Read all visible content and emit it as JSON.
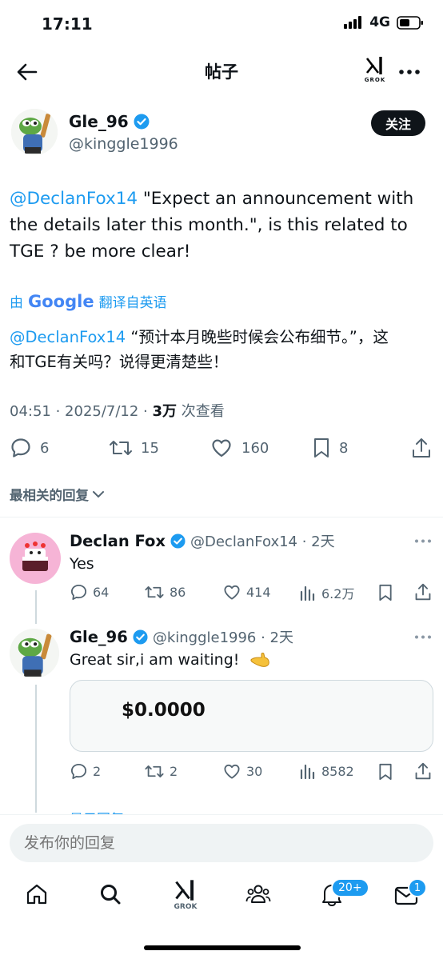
{
  "status_bar": {
    "time": "17:11",
    "network": "4G"
  },
  "header": {
    "title": "帖子",
    "grok_label": "GROK"
  },
  "post": {
    "display_name": "Gle_96",
    "handle": "@kinggle1996",
    "follow_label": "关注",
    "mention": "@DeclanFox14",
    "text_line1": " \"Expect an announcement with",
    "text_line2": "the details later this month.\", is this related to",
    "text_line3": "TGE ? be more clear!",
    "translate_prefix": "由",
    "translate_brand": "Google",
    "translate_suffix": "翻译自英语",
    "translated_mention": "@DeclanFox14",
    "translated_line1": " “预计本月晚些时候会公布细节。”，这",
    "translated_line2": "和TGE有关吗？说得更清楚些！",
    "time": "04:51 · 2025/7/12 · ",
    "views_count": "3万",
    "views_label": " 次查看",
    "replies": "6",
    "reposts": "15",
    "likes": "160",
    "bookmarks": "8"
  },
  "sort_label": "最相关的回复",
  "replies": [
    {
      "display_name": "Declan Fox",
      "handle": "@DeclanFox14 · 2天",
      "text": "Yes",
      "replies": "64",
      "reposts": "86",
      "likes": "414",
      "views": "6.2万"
    },
    {
      "display_name": "Gle_96",
      "handle": "@kinggle1996 · 2天",
      "text": "Great sir,i am waiting!",
      "card_value": "$0.0000",
      "replies": "2",
      "reposts": "2",
      "likes": "30",
      "views": "8582"
    }
  ],
  "show_replies_label": "显示回复",
  "composer": {
    "placeholder": "发布你的回复"
  },
  "tabbar": {
    "grok_label": "GROK",
    "notifications_badge": "20+",
    "messages_badge": "1"
  },
  "colors": {
    "accent": "#1d9bf0",
    "text": "#0f1419",
    "muted": "#536471"
  }
}
